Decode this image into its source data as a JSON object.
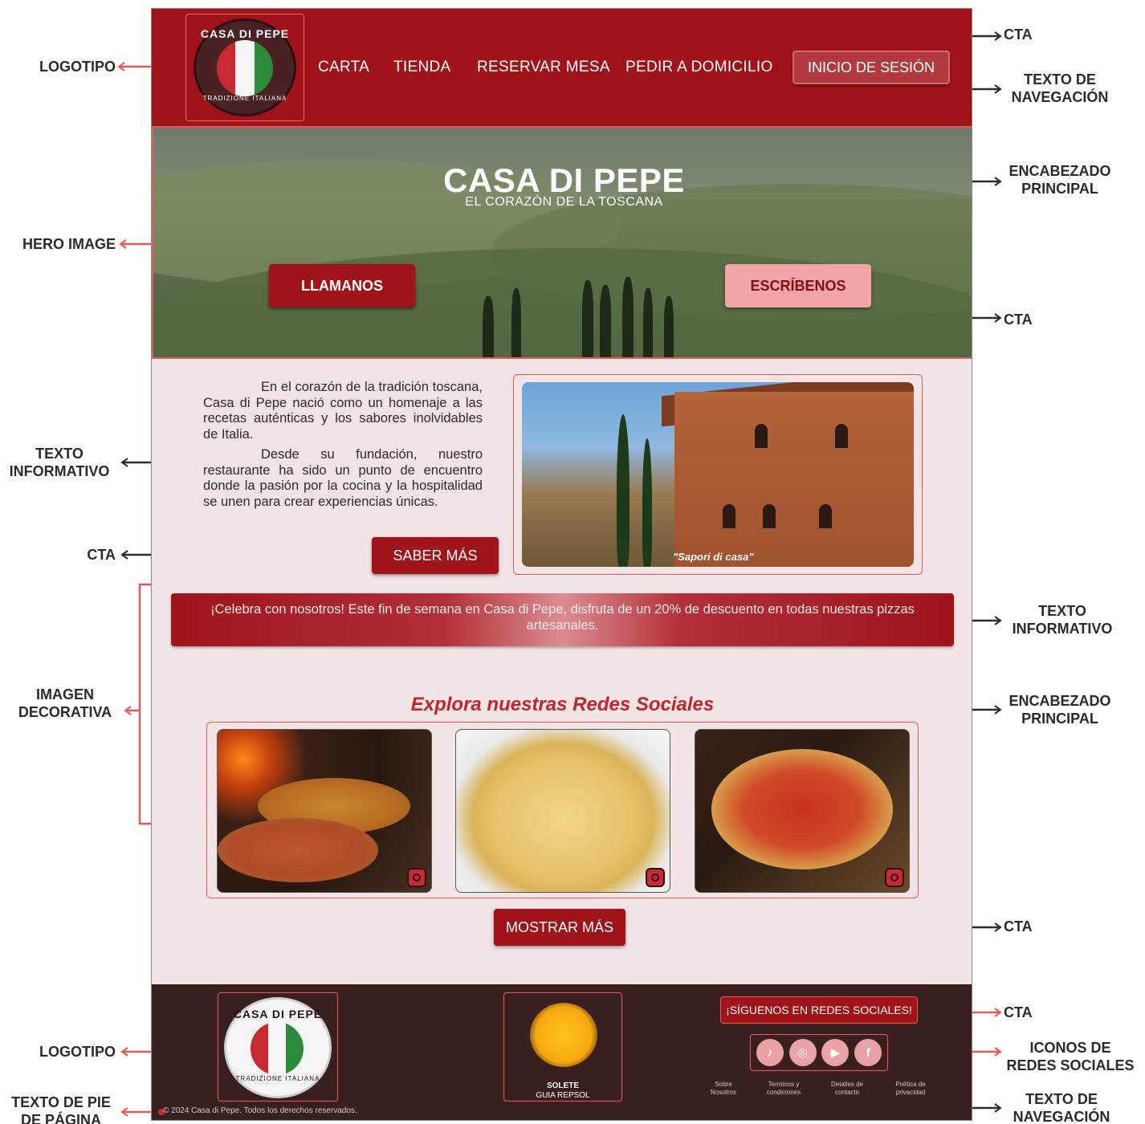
{
  "annotations_left": {
    "logotipo_top": "LOGOTIPO",
    "hero_image": "HERO IMAGE",
    "texto_informativo": [
      "TEXTO",
      "INFORMATIVO"
    ],
    "cta_saber": "CTA",
    "imagen_decorativa": [
      "IMAGEN",
      "DECORATIVA"
    ],
    "logotipo_footer": "LOGOTIPO",
    "texto_pie": [
      "TEXTO DE PIE",
      "DE PÁGINA"
    ]
  },
  "annotations_right": {
    "cta_login": "CTA",
    "texto_navegacion_top": [
      "TEXTO DE",
      "NAVEGACIÓN"
    ],
    "encabezado_principal_hero": [
      "ENCABEZADO",
      "PRINCIPAL"
    ],
    "cta_hero": "CTA",
    "texto_informativo_promo": [
      "TEXTO",
      "INFORMATIVO"
    ],
    "encabezado_principal_social": [
      "ENCABEZADO",
      "PRINCIPAL"
    ],
    "cta_mostrar": "CTA",
    "cta_siguenos": "CTA",
    "iconos_redes": [
      "ICONOS DE",
      "REDES SOCIALES"
    ],
    "texto_navegacion_footer": [
      "TEXTO DE",
      "NAVEGACIÓN"
    ]
  },
  "header": {
    "logo_top": "CASA DI PEPE",
    "logo_bottom": "TRADIZIONE ITALIANA",
    "nav": [
      "CARTA",
      "TIENDA",
      "RESERVAR MESA",
      "PEDIR A DOMICILIO"
    ],
    "login": "INICIO DE SESIÓN"
  },
  "hero": {
    "title": "CASA DI PEPE",
    "subtitle": "EL CORAZÓN DE LA TOSCANA",
    "call_button": "LLAMANOS",
    "write_button": "ESCRÍBENOS"
  },
  "about": {
    "paragraph1": "En el corazón de la tradición toscana, Casa di Pepe nació como un homenaje a las recetas auténticas y los sabores inolvidables de Italia.",
    "paragraph2": "Desde su fundación, nuestro restaurante ha sido un punto de encuentro donde la pasión por la cocina y la hospitalidad se unen para crear experiencias únicas.",
    "button": "SABER MÁS",
    "photo_caption": "\"Sapori di casa\""
  },
  "promo": {
    "text": "¡Celebra con nosotros! Este fin de semana en Casa di Pepe, disfruta de un 20% de descuento en todas nuestras pizzas artesanales."
  },
  "social": {
    "title": "Explora nuestras Redes Sociales",
    "button": "MOSTRAR MÁS"
  },
  "footer": {
    "solete": [
      "SOLETE",
      "GUIA REPSOL"
    ],
    "follow": "¡SÍGUENOS EN REDES SOCIALES!",
    "icons": [
      "tiktok-icon",
      "instagram-icon",
      "youtube-icon",
      "facebook-icon"
    ],
    "links": [
      [
        "Sobre",
        "Nosotros"
      ],
      [
        "Terminos y",
        "condiciones"
      ],
      [
        "Detalles de",
        "contacto"
      ],
      [
        "Política de",
        "privacidad"
      ]
    ],
    "copyright": "© 2024 Casa di Pepe. Todos los derechos reservados."
  },
  "colors": {
    "brand_red": "#a01419",
    "annotation_red": "#e25a5a",
    "footer_bg": "#3a1f1f",
    "page_bg": "#f2e4e4"
  }
}
